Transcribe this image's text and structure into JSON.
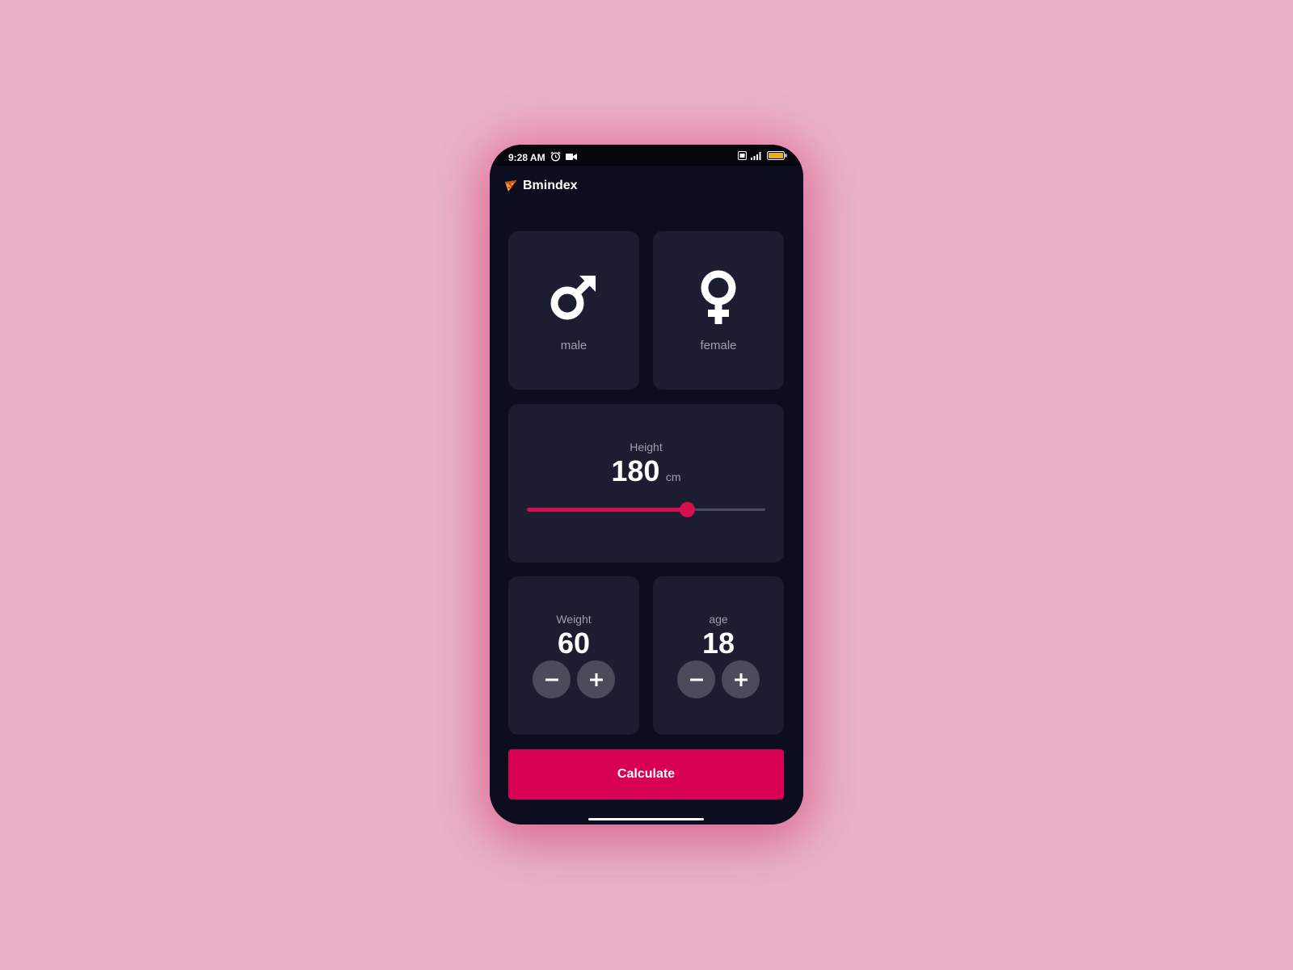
{
  "status_bar": {
    "time": "9:28 AM",
    "icons": [
      "alarm-icon",
      "video-camera-icon",
      "volte-icon",
      "signal-icon",
      "battery-icon"
    ]
  },
  "app_bar": {
    "icon": "pizza-icon",
    "title": "Bmindex"
  },
  "gender": {
    "male": {
      "label": "male",
      "icon": "male-symbol-icon"
    },
    "female": {
      "label": "female",
      "icon": "female-symbol-icon"
    }
  },
  "height": {
    "label": "Height",
    "value": "180",
    "unit": "cm",
    "slider_fraction": 0.67
  },
  "weight": {
    "label": "Weight",
    "value": "60"
  },
  "age": {
    "label": "age",
    "value": "18"
  },
  "actions": {
    "calculate_label": "Calculate"
  },
  "colors": {
    "background": "#e9b3c7",
    "screen": "#0c0e1f",
    "card": "#1c1d30",
    "accent": "#d80052",
    "muted_text": "#9e9fae",
    "round_button": "#4a4b5b"
  }
}
